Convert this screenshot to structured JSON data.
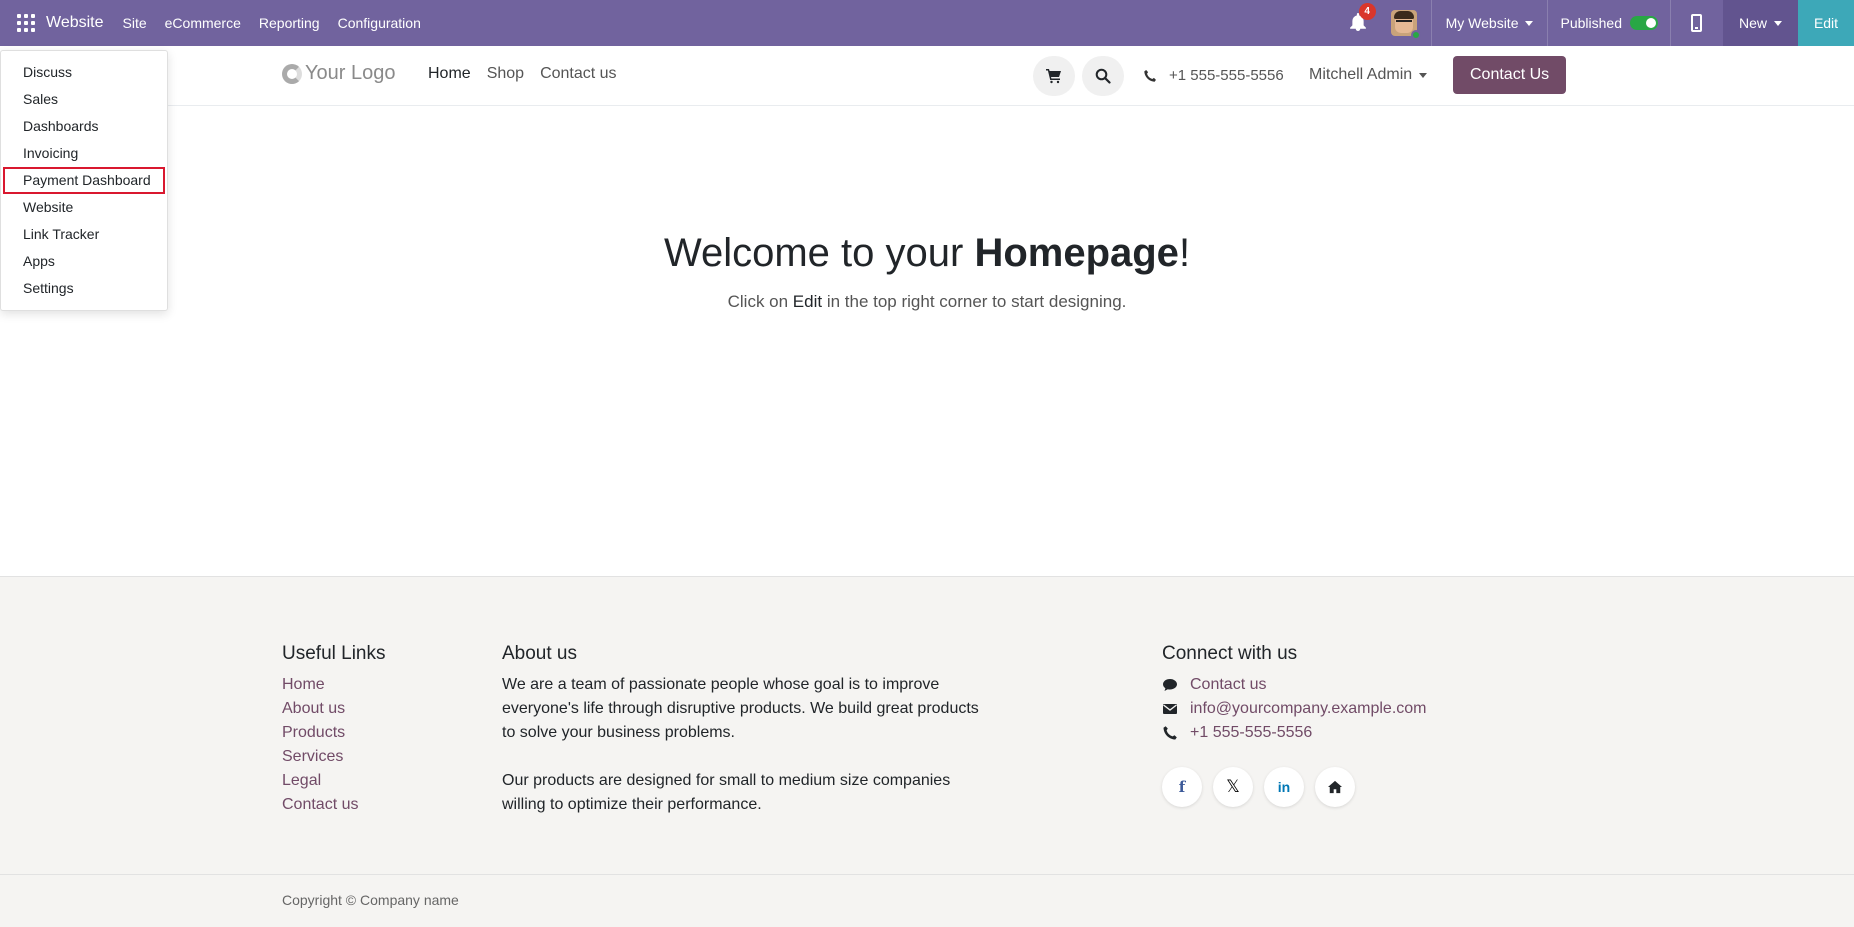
{
  "topbar": {
    "brand": "Website",
    "menu": [
      "Site",
      "eCommerce",
      "Reporting",
      "Configuration"
    ],
    "notifications_count": "4",
    "my_website": "My Website",
    "published_label": "Published",
    "published": true,
    "new_label": "New",
    "edit_label": "Edit",
    "bar_color": "#71639e"
  },
  "app_menu": {
    "items": [
      "Discuss",
      "Sales",
      "Dashboards",
      "Invoicing",
      "Payment Dashboard",
      "Website",
      "Link Tracker",
      "Apps",
      "Settings"
    ],
    "highlighted": "Payment Dashboard"
  },
  "site_header": {
    "logo": "Your Logo",
    "nav": [
      "Home",
      "Shop",
      "Contact us"
    ],
    "active_nav": "Home",
    "phone": "+1 555-555-5556",
    "user": "Mitchell Admin",
    "contact_button": "Contact Us",
    "accent_color": "#714b67"
  },
  "hero": {
    "title_prefix": "Welcome to your ",
    "title_bold": "Homepage",
    "title_suffix": "!",
    "subtitle_prefix": "Click on ",
    "subtitle_em": "Edit",
    "subtitle_suffix": " in the top right corner to start designing."
  },
  "footer": {
    "useful_links": {
      "heading": "Useful Links",
      "links": [
        "Home",
        "About us",
        "Products",
        "Services",
        "Legal",
        "Contact us"
      ]
    },
    "about": {
      "heading": "About us",
      "line1": "We are a team of passionate people whose goal is to improve",
      "line2": "everyone's life through disruptive products. We build great products",
      "line3": "to solve your business problems.",
      "line4": "Our products are designed for small to medium size companies",
      "line5": "willing to optimize their performance."
    },
    "connect": {
      "heading": "Connect with us",
      "contact": "Contact us",
      "email": "info@yourcompany.example.com",
      "phone": "+1 555-555-5556",
      "socials": [
        "facebook-icon",
        "x-icon",
        "linkedin-icon",
        "home-icon"
      ]
    }
  },
  "copyright": "Copyright © Company name"
}
